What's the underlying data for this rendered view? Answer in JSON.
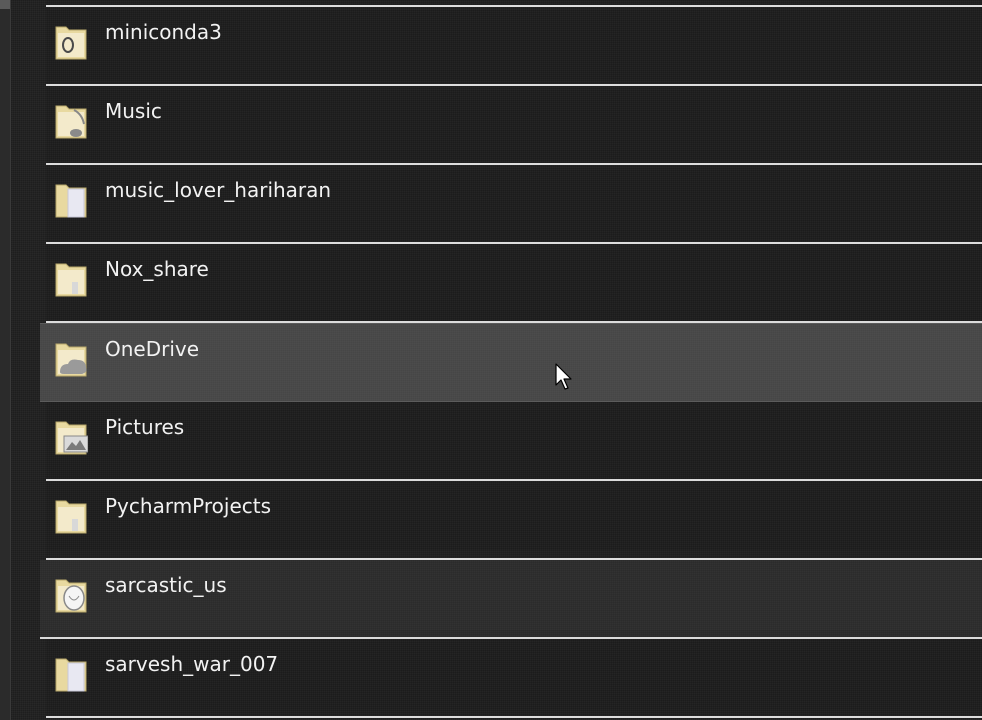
{
  "folders": [
    {
      "name": "",
      "overlay": "none",
      "state": "normal"
    },
    {
      "name": "miniconda3",
      "overlay": "ring",
      "state": "normal"
    },
    {
      "name": "Music",
      "overlay": "note",
      "state": "normal"
    },
    {
      "name": "music_lover_hariharan",
      "overlay": "doc",
      "state": "normal"
    },
    {
      "name": "Nox_share",
      "overlay": "small-doc",
      "state": "normal"
    },
    {
      "name": "OneDrive",
      "overlay": "cloud",
      "state": "hovered"
    },
    {
      "name": "Pictures",
      "overlay": "picture",
      "state": "normal"
    },
    {
      "name": "PycharmProjects",
      "overlay": "small-doc",
      "state": "normal"
    },
    {
      "name": "sarcastic_us",
      "overlay": "sketch",
      "state": "subtle"
    },
    {
      "name": "sarvesh_war_007",
      "overlay": "doc",
      "state": "normal"
    }
  ],
  "icons": {
    "folder": "folder-icon",
    "cursor": "mouse-pointer-icon"
  },
  "colors": {
    "background": "#1e1e1e",
    "row_divider": "#dcdcdc",
    "hover_row": "#6b6b6b",
    "folder_tan": "#e8d9a0",
    "text": "#f2f2f2"
  }
}
